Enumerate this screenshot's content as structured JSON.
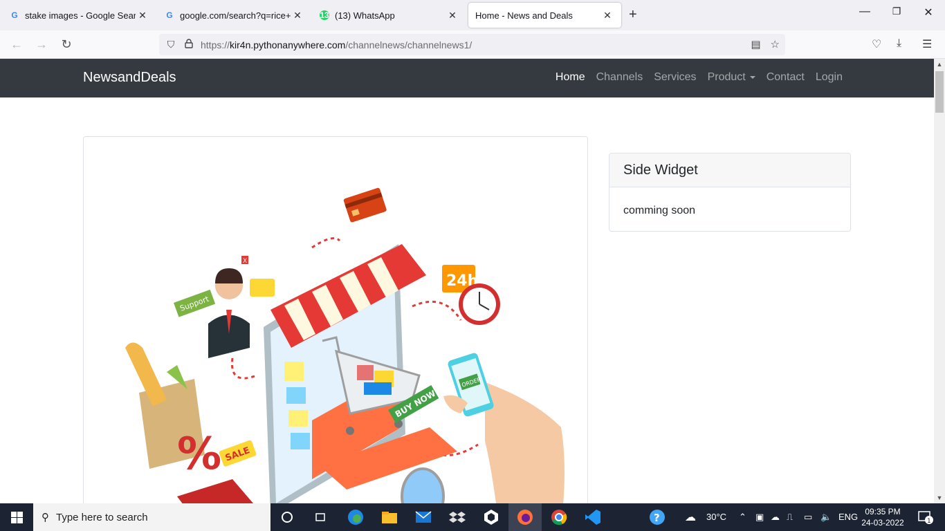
{
  "browser": {
    "tabs": [
      {
        "title": "stake images - Google Search",
        "favicon": "google-icon",
        "active": false
      },
      {
        "title": "google.com/search?q=rice+foo",
        "favicon": "google-icon",
        "active": false
      },
      {
        "title": "(13) WhatsApp",
        "favicon": "whatsapp-icon",
        "badge": "13",
        "active": false
      },
      {
        "title": "Home - News and Deals",
        "favicon": "",
        "active": true
      }
    ],
    "url_scheme": "https://",
    "url_host": "kir4n.pythonanywhere.com",
    "url_path": "/channelnews/channelnews1/"
  },
  "site": {
    "brand": "NewsandDeals",
    "nav": [
      "Home",
      "Channels",
      "Services",
      "Product",
      "Contact",
      "Login"
    ],
    "widget_title": "Side Widget",
    "widget_body": "comming soon",
    "hero_texts": {
      "support": "Support",
      "h24": "24h",
      "buy": "BUY NOW",
      "order": "ORDER",
      "sale": "SALE",
      "x": "X"
    }
  },
  "taskbar": {
    "search_placeholder": "Type here to search",
    "temperature": "30°C",
    "language": "ENG",
    "time": "09:35 PM",
    "date": "24-03-2022",
    "notification_count": "1"
  },
  "colors": {
    "navbar": "#343a40",
    "taskbar": "#1c2434",
    "tabstrip": "#f0f0f4"
  }
}
